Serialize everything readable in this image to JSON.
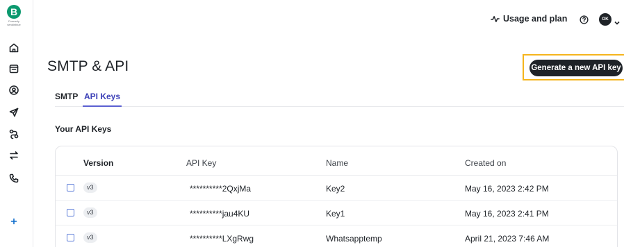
{
  "brand": {
    "letter": "B",
    "subtitle": "Formerly sendinblue"
  },
  "sidebar": {
    "items": [
      {
        "name": "home-icon"
      },
      {
        "name": "calendar-icon"
      },
      {
        "name": "contacts-icon"
      },
      {
        "name": "send-icon"
      },
      {
        "name": "automation-icon"
      },
      {
        "name": "transfer-icon"
      },
      {
        "name": "phone-icon"
      },
      {
        "name": "plus-icon"
      }
    ]
  },
  "topbar": {
    "usage_label": "Usage and plan",
    "avatar_initials": "OK"
  },
  "page": {
    "title": "SMTP & API",
    "generate_button": "Generate a new API key",
    "highlight_color": "#f5b51d"
  },
  "tabs": [
    {
      "label": "SMTP",
      "active": false
    },
    {
      "label": "API Keys",
      "active": true
    }
  ],
  "section_label": "Your API Keys",
  "table": {
    "headers": {
      "version": "Version",
      "api_key": "API Key",
      "name": "Name",
      "created_on": "Created on"
    },
    "rows": [
      {
        "version": "v3",
        "api_key": "**********2QxjMa",
        "name": "Key2",
        "created_on": "May 16, 2023 2:42 PM"
      },
      {
        "version": "v3",
        "api_key": "**********jau4KU",
        "name": "Key1",
        "created_on": "May 16, 2023 2:41 PM"
      },
      {
        "version": "v3",
        "api_key": "**********LXgRwg",
        "name": "Whatsapptemp",
        "created_on": "April 21, 2023 7:46 AM"
      }
    ]
  }
}
